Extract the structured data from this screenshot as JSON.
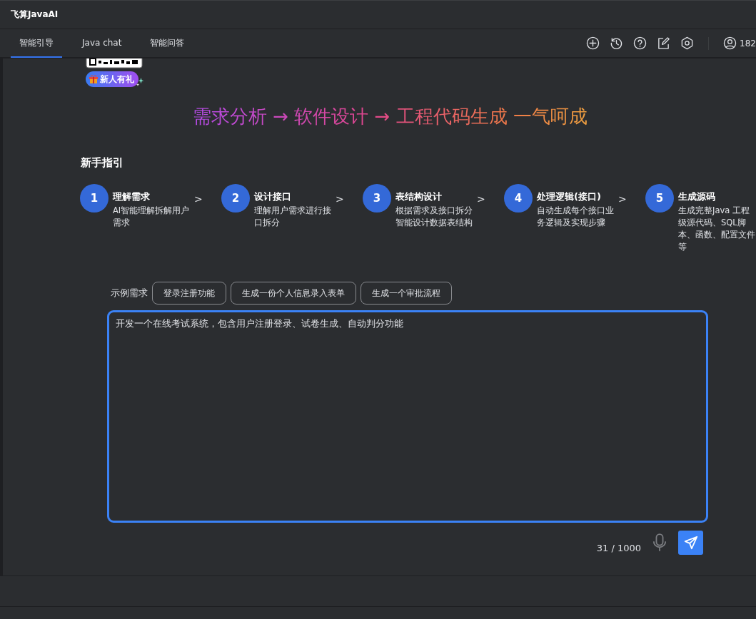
{
  "window": {
    "title": "飞算JavaAI"
  },
  "tabs": [
    {
      "label": "智能引导",
      "selected": true
    },
    {
      "label": "Java chat",
      "selected": false
    },
    {
      "label": "智能问答",
      "selected": false
    }
  ],
  "toolbar": {
    "user": "182"
  },
  "promo_badge": "新人有礼",
  "headline": "需求分析 → 软件设计 → 工程代码生成 一气呵成",
  "guide": {
    "title": "新手指引",
    "separator": ">",
    "steps": [
      {
        "number": "1",
        "title": "理解需求",
        "description": "AI智能理解拆解用户需求"
      },
      {
        "number": "2",
        "title": "设计接口",
        "description": "理解用户需求进行接口拆分"
      },
      {
        "number": "3",
        "title": "表结构设计",
        "description": "根据需求及接口拆分智能设计数据表结构"
      },
      {
        "number": "4",
        "title": "处理逻辑(接口)",
        "description": "自动生成每个接口业务逻辑及实现步骤"
      },
      {
        "number": "5",
        "title": "生成源码",
        "description": "生成完整Java 工程级源代码、SQL脚本、函数、配置文件等"
      }
    ]
  },
  "examples": {
    "label": "示例需求",
    "items": [
      "登录注册功能",
      "生成一份个人信息录入表单",
      "生成一个审批流程"
    ]
  },
  "input": {
    "value": "开发一个在线考试系统，包含用户注册登录、试卷生成、自动判分功能",
    "counter": "31 / 1000"
  }
}
